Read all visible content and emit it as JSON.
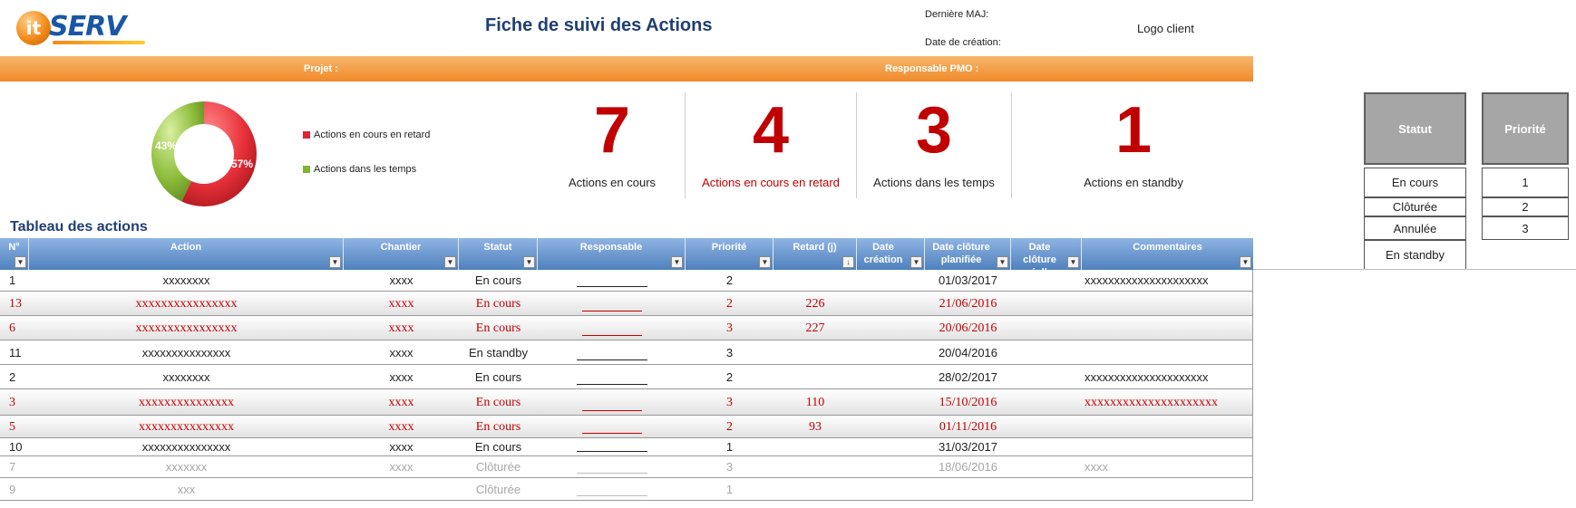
{
  "header": {
    "logo_text_it": "it",
    "logo_text_serv": "SERV",
    "title": "Fiche de suivi des Actions",
    "derniere_maj_label": "Dernière  MAJ:",
    "date_creation_label": "Date de création:",
    "logo_client": "Logo client"
  },
  "band": {
    "projet_label": "Projet :",
    "responsable_label": "Responsable PMO :"
  },
  "donut": {
    "late_pct_label": "57%",
    "ontime_pct_label": "43%",
    "late_fraction": 0.57,
    "ontime_fraction": 0.43,
    "late_color": "#e8313a",
    "ontime_color": "#8cbc3a",
    "legend": [
      {
        "label": "Actions en cours en retard",
        "color": "#d9262e"
      },
      {
        "label": "Actions dans les temps",
        "color": "#7fb536"
      }
    ]
  },
  "kpis": [
    {
      "value": "7",
      "label": "Actions en cours",
      "red_label": false
    },
    {
      "value": "4",
      "label": "Actions en cours en retard",
      "red_label": true
    },
    {
      "value": "3",
      "label": "Actions dans les temps",
      "red_label": false
    },
    {
      "value": "1",
      "label": "Actions en standby",
      "red_label": false
    }
  ],
  "reference": {
    "statut_header": "Statut",
    "priorite_header": "Priorité",
    "statuts": [
      "En cours",
      "Clôturée",
      "Annulée",
      "En standby"
    ],
    "priorites": [
      "1",
      "2",
      "3"
    ]
  },
  "section_title": "Tableau des actions",
  "columns": [
    {
      "key": "num",
      "label": "N°"
    },
    {
      "key": "action",
      "label": "Action"
    },
    {
      "key": "chantier",
      "label": "Chantier"
    },
    {
      "key": "statut",
      "label": "Statut"
    },
    {
      "key": "responsable",
      "label": "Responsable"
    },
    {
      "key": "priorite",
      "label": "Priorité"
    },
    {
      "key": "retard",
      "label": "Retard (j)"
    },
    {
      "key": "creation",
      "label": "Date création"
    },
    {
      "key": "planifiee",
      "label": "Date clôture planifiée"
    },
    {
      "key": "reelle",
      "label": "Date clôture réelle"
    },
    {
      "key": "commentaires",
      "label": "Commentaires"
    }
  ],
  "rows": [
    {
      "num": "1",
      "action": "xxxxxxxx",
      "chantier": "xxxx",
      "statut": "En cours",
      "priorite": "2",
      "retard": "",
      "planifiee": "01/03/2017",
      "commentaires": "xxxxxxxxxxxxxxxxxxxxx",
      "style": "normal"
    },
    {
      "num": "13",
      "action": "xxxxxxxxxxxxxxxx",
      "chantier": "xxxx",
      "statut": "En cours",
      "priorite": "2",
      "retard": "226",
      "planifiee": "21/06/2016",
      "commentaires": "",
      "style": "late"
    },
    {
      "num": "6",
      "action": "xxxxxxxxxxxxxxxx",
      "chantier": "xxxx",
      "statut": "En cours",
      "priorite": "3",
      "retard": "227",
      "planifiee": "20/06/2016",
      "commentaires": "",
      "style": "late"
    },
    {
      "num": "11",
      "action": "xxxxxxxxxxxxxxx",
      "chantier": "xxxx",
      "statut": "En standby",
      "priorite": "3",
      "retard": "",
      "planifiee": "20/04/2016",
      "commentaires": "",
      "style": "normal"
    },
    {
      "num": "2",
      "action": "xxxxxxxx",
      "chantier": "xxxx",
      "statut": "En cours",
      "priorite": "2",
      "retard": "",
      "planifiee": "28/02/2017",
      "commentaires": "xxxxxxxxxxxxxxxxxxxxx",
      "style": "normal"
    },
    {
      "num": "3",
      "action": "xxxxxxxxxxxxxxx",
      "chantier": "xxxx",
      "statut": "En cours",
      "priorite": "3",
      "retard": "110",
      "planifiee": "15/10/2016",
      "commentaires": "xxxxxxxxxxxxxxxxxxxxx",
      "style": "late"
    },
    {
      "num": "5",
      "action": "xxxxxxxxxxxxxxx",
      "chantier": "xxxx",
      "statut": "En cours",
      "priorite": "2",
      "retard": "93",
      "planifiee": "01/11/2016",
      "commentaires": "",
      "style": "late"
    },
    {
      "num": "10",
      "action": "xxxxxxxxxxxxxxx",
      "chantier": "xxxx",
      "statut": "En cours",
      "priorite": "1",
      "retard": "",
      "planifiee": "31/03/2017",
      "commentaires": "",
      "style": "normal"
    },
    {
      "num": "7",
      "action": "xxxxxxx",
      "chantier": "xxxx",
      "statut": "Clôturée",
      "priorite": "3",
      "retard": "",
      "planifiee": "18/06/2016",
      "commentaires": "xxxx",
      "style": "closed"
    },
    {
      "num": "9",
      "action": "xxx",
      "chantier": "",
      "statut": "Clôturée",
      "priorite": "1",
      "retard": "",
      "planifiee": "",
      "commentaires": "",
      "style": "closed"
    }
  ]
}
